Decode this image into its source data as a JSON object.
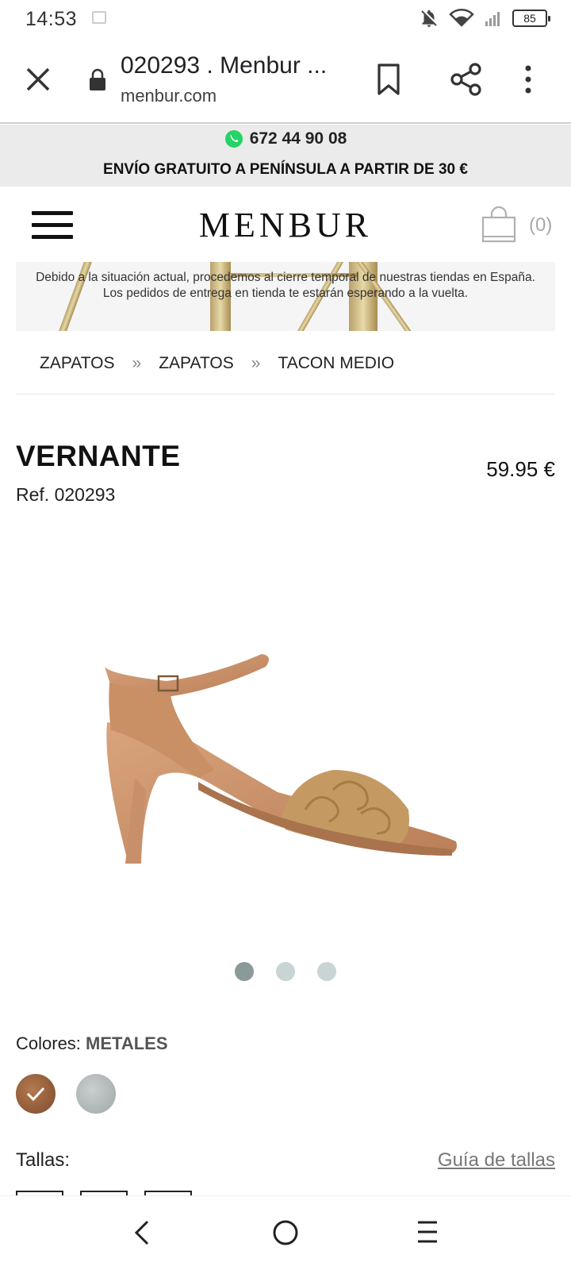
{
  "status_bar": {
    "time": "14:53",
    "battery": "85",
    "icons": [
      "notifications-off-icon",
      "wifi-icon",
      "signal-icon",
      "battery-icon"
    ]
  },
  "browser": {
    "title": "020293 . Menbur ...",
    "url": "menbur.com",
    "icons": [
      "close-icon",
      "lock-icon",
      "bookmark-icon",
      "share-icon",
      "more-vert-icon"
    ]
  },
  "promo": {
    "phone": "672 44 90 08",
    "shipping": "ENVÍO GRATUITO A PENÍNSULA A PARTIR DE 30 €"
  },
  "header": {
    "logo": "MENBUR",
    "cart_count": "(0)"
  },
  "notice": {
    "text": "Debido a la situación actual, procedemos al cierre temporal de nuestras tiendas en España. Los pedidos de entrega en tienda te estarán esperando a la vuelta."
  },
  "breadcrumb": {
    "items": [
      "ZAPATOS",
      "ZAPATOS",
      "TACON MEDIO"
    ],
    "separator": "»"
  },
  "product": {
    "name": "VERNANTE",
    "ref": "Ref. 020293",
    "price": "59.95 €",
    "image_count": 3,
    "active_image": 1
  },
  "colors": {
    "label": "Colores:",
    "selected": "METALES",
    "swatches": [
      "#9c6440",
      "#b5bcbc"
    ]
  },
  "sizes": {
    "label": "Tallas:",
    "guide": "Guía de tallas"
  },
  "colors_ui": {
    "accent": "#111111",
    "promo_bg": "#ebebeb",
    "whatsapp": "#25d366"
  }
}
